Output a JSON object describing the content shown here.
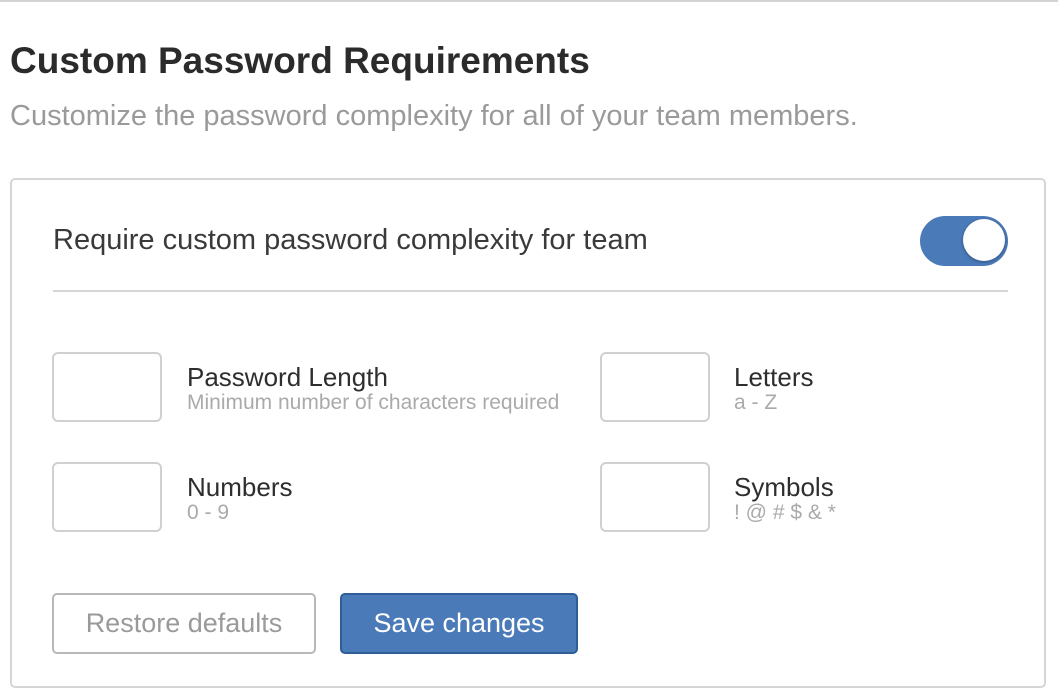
{
  "header": {
    "title": "Custom Password Requirements",
    "subtitle": "Customize the password complexity for all of your team members."
  },
  "card": {
    "toggle_label": "Require custom password complexity for team",
    "toggle_on": true,
    "options": {
      "length": {
        "title": "Password Length",
        "desc": "Minimum number of characters required",
        "value": ""
      },
      "letters": {
        "title": "Letters",
        "desc": "a - Z",
        "value": ""
      },
      "numbers": {
        "title": "Numbers",
        "desc": "0 - 9",
        "value": ""
      },
      "symbols": {
        "title": "Symbols",
        "desc": "! @ # $ & *",
        "value": ""
      }
    },
    "buttons": {
      "restore_label": "Restore defaults",
      "save_label": "Save changes"
    }
  },
  "colors": {
    "accent": "#4a7ab8",
    "border": "#d6d6d6",
    "muted_text": "#9a9a9a"
  }
}
